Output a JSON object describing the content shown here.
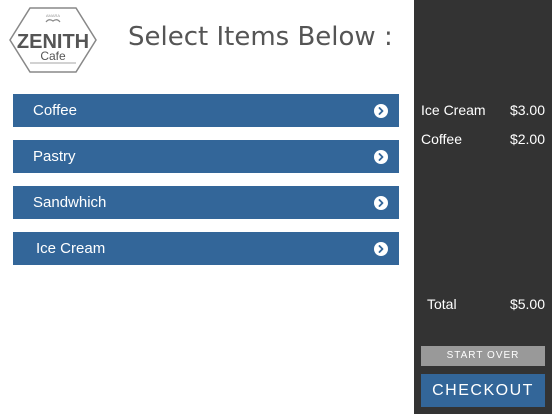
{
  "logo": {
    "brand": "ZENITH",
    "subtitle": "Cafe",
    "tagline": "AMARA"
  },
  "header": {
    "title": "Select Items Below :"
  },
  "menu": {
    "items": [
      {
        "label": "Coffee"
      },
      {
        "label": "Pastry"
      },
      {
        "label": "Sandwhich"
      },
      {
        "label": "Ice Cream"
      }
    ]
  },
  "order": {
    "items": [
      {
        "name": "Ice Cream",
        "price": "$3.00"
      },
      {
        "name": "Coffee",
        "price": "$2.00"
      }
    ],
    "total_label": "Total",
    "total_value": "$5.00"
  },
  "actions": {
    "start_over": "START OVER",
    "checkout": "CHECKOUT"
  },
  "colors": {
    "accent": "#336699",
    "sidebar": "#333333",
    "secondary_button": "#999999"
  }
}
